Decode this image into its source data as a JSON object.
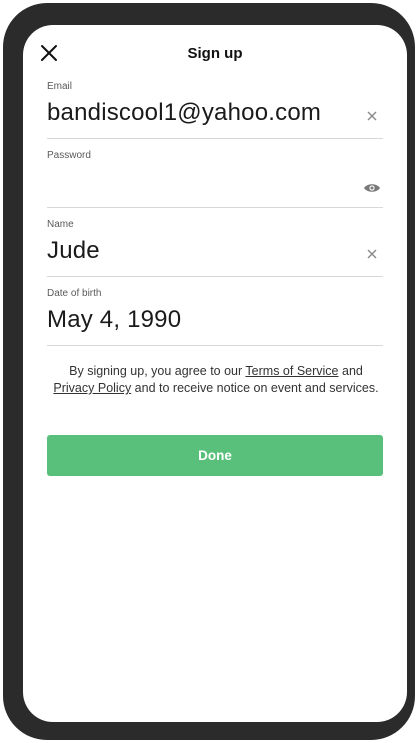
{
  "header": {
    "title": "Sign up",
    "close_icon": "close-icon"
  },
  "email": {
    "label": "Email",
    "value": "bandiscool1@yahoo.com",
    "action_icon": "clear-icon"
  },
  "password": {
    "label": "Password",
    "value": "",
    "action_icon": "eye-icon"
  },
  "name": {
    "label": "Name",
    "value": "Jude",
    "action_icon": "clear-icon"
  },
  "dob": {
    "label": "Date of birth",
    "value": "May 4, 1990"
  },
  "terms": {
    "prefix": "By signing up, you agree to our ",
    "terms_link": "Terms of Service",
    "and": " and ",
    "privacy_link": "Privacy Policy",
    "suffix": " and to receive notice on event and services."
  },
  "done_button": {
    "label": "Done"
  },
  "colors": {
    "accent": "#58c07a",
    "frame": "#2b2b2b",
    "divider": "#d8d8d8"
  }
}
